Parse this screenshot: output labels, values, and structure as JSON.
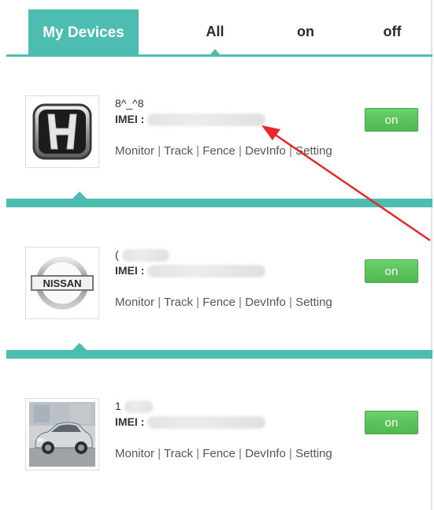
{
  "header": {
    "brand": "My Devices",
    "tabs": [
      {
        "label": "All",
        "active": true
      },
      {
        "label": "on",
        "active": false
      },
      {
        "label": "off",
        "active": false
      }
    ]
  },
  "devices": [
    {
      "name": "8^_^8",
      "imei_label": "IMEI :",
      "imei_value": "(redacted)",
      "logo": "honda-logo",
      "links": [
        "Monitor",
        "Track",
        "Fence",
        "DevInfo",
        "Setting"
      ],
      "status": "on"
    },
    {
      "name": "(",
      "imei_label": "IMEI :",
      "imei_value": "(redacted)",
      "logo": "nissan-logo",
      "logo_text": "NISSAN",
      "links": [
        "Monitor",
        "Track",
        "Fence",
        "DevInfo",
        "Setting"
      ],
      "status": "on"
    },
    {
      "name": "1",
      "imei_label": "IMEI :",
      "imei_value": "(redacted)",
      "logo": "car-photo",
      "links": [
        "Monitor",
        "Track",
        "Fence",
        "DevInfo",
        "Setting"
      ],
      "status": "on"
    }
  ],
  "separator": " | ",
  "colors": {
    "accent": "#4dbdb1",
    "status_on": "#5cb85c",
    "annotation_arrow": "#e8262b"
  }
}
